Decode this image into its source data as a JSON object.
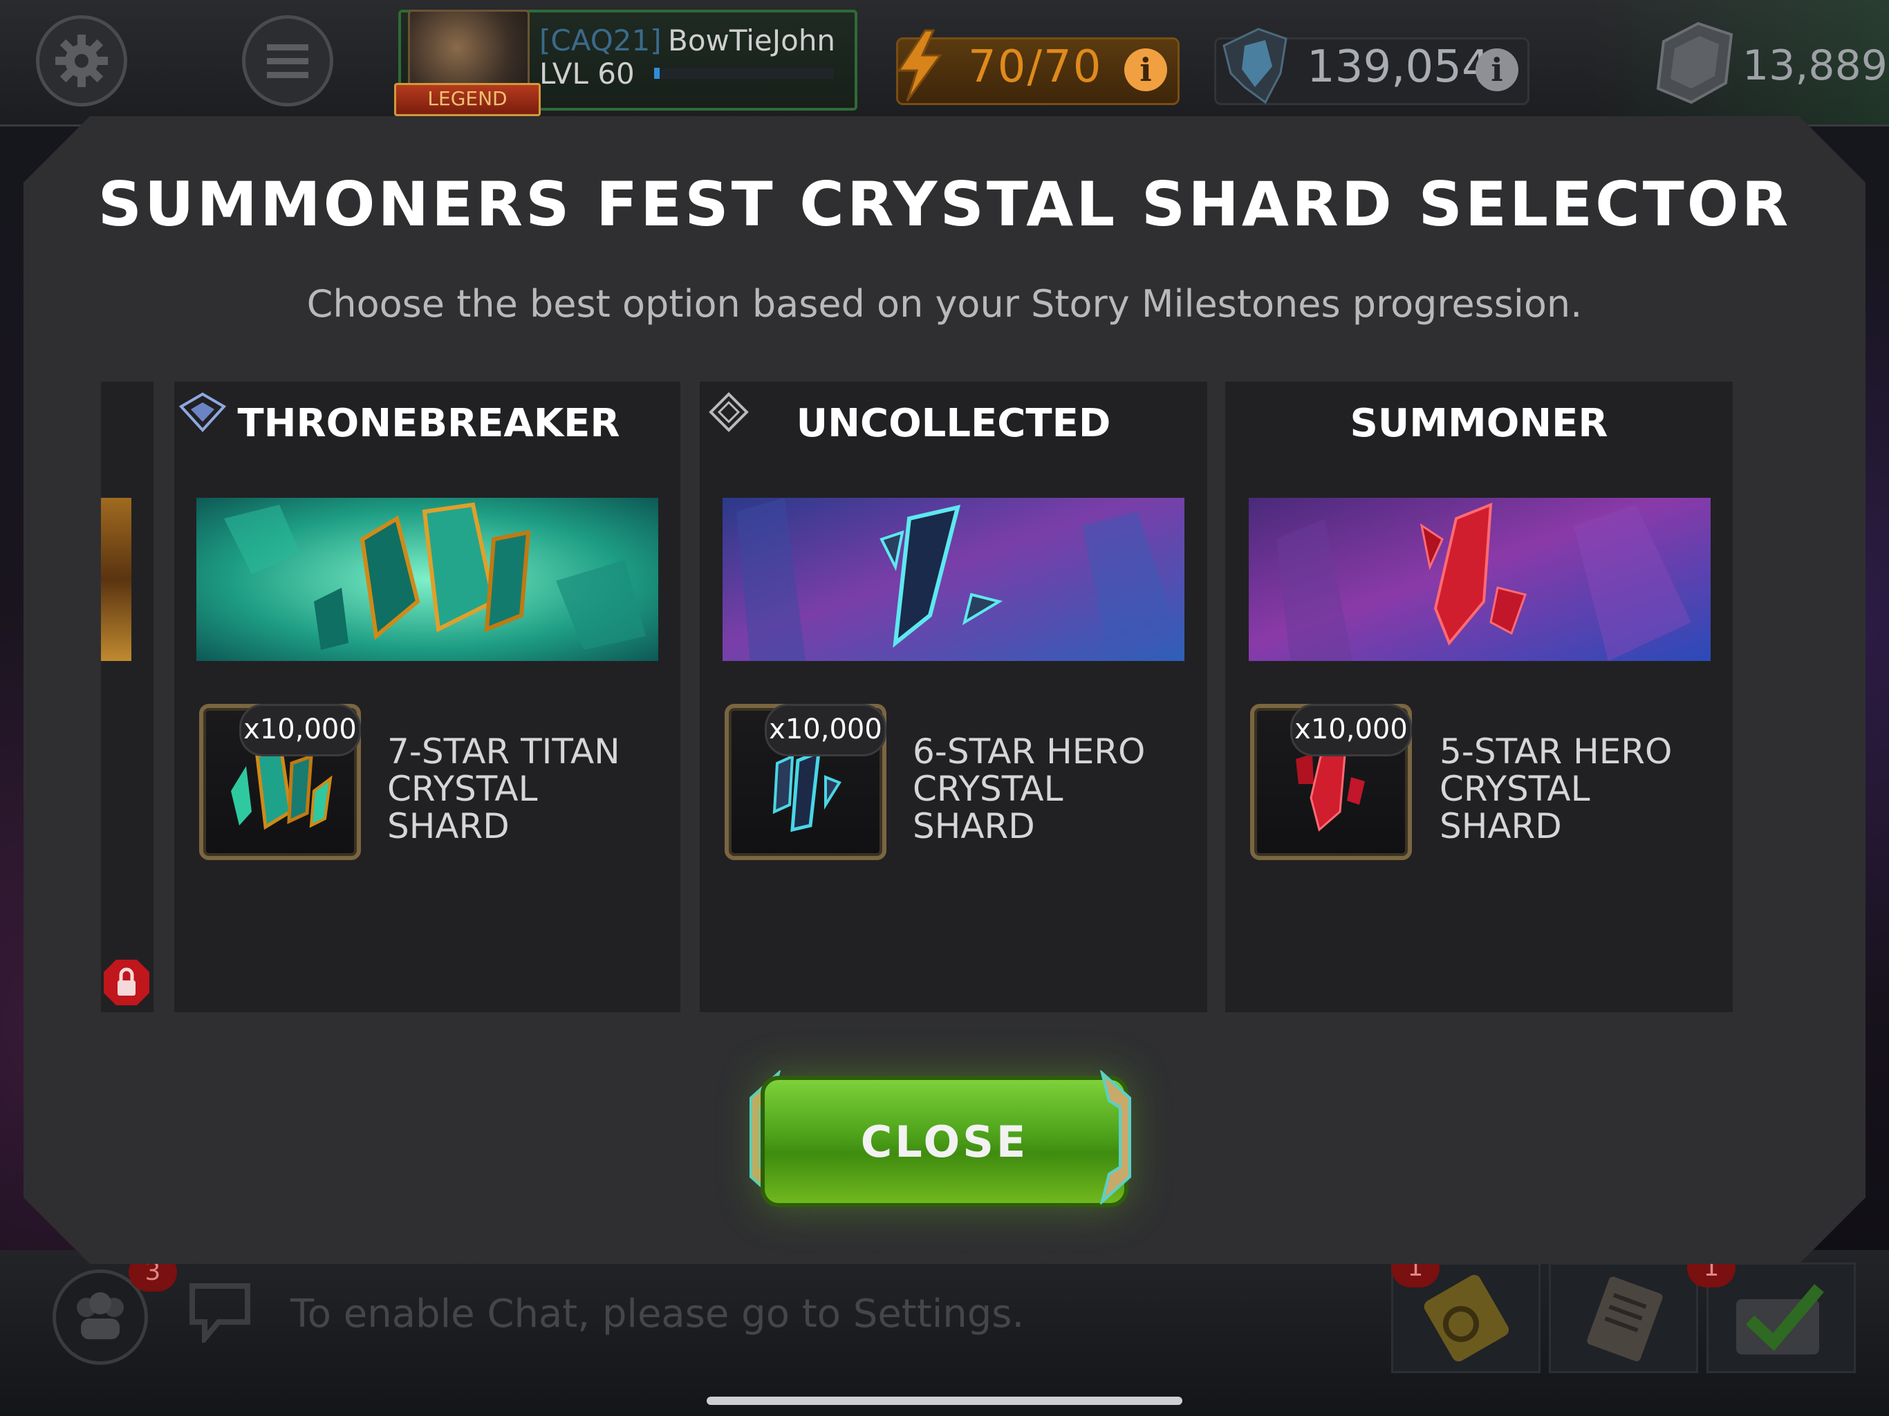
{
  "topbar": {
    "alliance_tag": "[CAQ21]",
    "player_name": "BowTieJohn",
    "level": "LVL 60",
    "rank_badge": "LEGEND",
    "energy": "70/70",
    "units": "139,054",
    "gold": "13,889",
    "info_glyph": "i"
  },
  "modal": {
    "title": "SUMMONERS FEST CRYSTAL SHARD SELECTOR",
    "subtitle": "Choose the best option based on your Story Milestones progression.",
    "close_label": "CLOSE"
  },
  "cards": [
    {
      "title": "THRONEBREAKER",
      "quantity": "x10,000",
      "item_line1": "7-STAR TITAN",
      "item_line2": "CRYSTAL SHARD",
      "accent": "#2fc9a0"
    },
    {
      "title": "UNCOLLECTED",
      "quantity": "x10,000",
      "item_line1": "6-STAR HERO",
      "item_line2": "CRYSTAL SHARD",
      "accent": "#4ad6e6"
    },
    {
      "title": "SUMMONER",
      "quantity": "x10,000",
      "item_line1": "5-STAR HERO",
      "item_line2": "CRYSTAL SHARD",
      "accent": "#e0303f"
    }
  ],
  "bottombar": {
    "chat_placeholder": "To enable Chat, please go to Settings.",
    "alliance_badge_count": "3",
    "quests_badge_count": "1",
    "inbox_badge_count": "1"
  }
}
